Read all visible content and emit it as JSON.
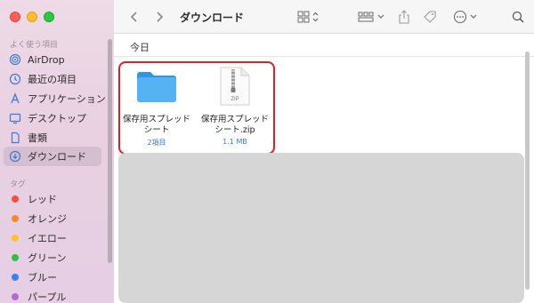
{
  "window": {
    "title": "ダウンロード"
  },
  "sidebar": {
    "favorites_header": "よく使う項目",
    "items": [
      {
        "label": "AirDrop",
        "icon": "airdrop-icon"
      },
      {
        "label": "最近の項目",
        "icon": "clock-icon"
      },
      {
        "label": "アプリケーション",
        "icon": "applications-icon"
      },
      {
        "label": "デスクトップ",
        "icon": "desktop-icon"
      },
      {
        "label": "書類",
        "icon": "document-icon"
      },
      {
        "label": "ダウンロード",
        "icon": "download-icon",
        "selected": true
      }
    ],
    "tags_header": "タグ",
    "tags": [
      {
        "label": "レッド",
        "color": "#fe4a3f"
      },
      {
        "label": "オレンジ",
        "color": "#ff8a1f"
      },
      {
        "label": "イエロー",
        "color": "#fec22d"
      },
      {
        "label": "グリーン",
        "color": "#2fc04a"
      },
      {
        "label": "ブルー",
        "color": "#3a80f6"
      },
      {
        "label": "パープル",
        "color": "#b766d6"
      }
    ]
  },
  "content": {
    "group_header": "今日",
    "files": [
      {
        "name": "保存用スプレッドシート",
        "detail": "2項目",
        "kind": "folder"
      },
      {
        "name": "保存用スプレッドシート.zip",
        "detail": "1.1 MB",
        "kind": "zip",
        "badge": "ZIP"
      }
    ]
  },
  "colors": {
    "accent": "#3b7ad6",
    "highlight": "#e02020",
    "folder": "#3ea4ef"
  }
}
